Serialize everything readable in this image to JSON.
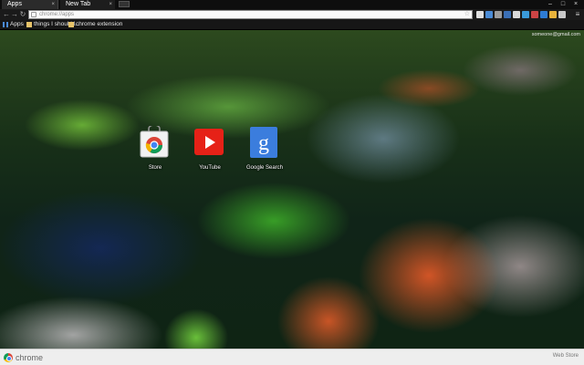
{
  "tabs": [
    {
      "label": "Apps",
      "active": true
    },
    {
      "label": "New Tab",
      "active": false
    }
  ],
  "window_controls": [
    "–",
    "□",
    "×"
  ],
  "address_bar": {
    "url": "chrome://apps"
  },
  "bookmarks": [
    {
      "label": "Apps",
      "icon": "apps-grid-icon"
    },
    {
      "label": "things I should l...",
      "icon": "folder-icon"
    },
    {
      "label": "chrome extension",
      "icon": "folder-icon"
    }
  ],
  "user_email": "someone@gmail.com",
  "apps": [
    {
      "label": "Store",
      "icon": "chrome-web-store-icon"
    },
    {
      "label": "YouTube",
      "icon": "youtube-icon"
    },
    {
      "label": "Google Search",
      "icon": "google-search-icon"
    }
  ],
  "footer": {
    "brand": "chrome",
    "web_store_link": "Web Store"
  },
  "colors": {
    "tab_active": "#2b2b2b",
    "toolbar": "#1a1a1a",
    "omnibox": "#fafafa",
    "youtube_red": "#e62117",
    "google_blue": "#3b7ddd"
  }
}
